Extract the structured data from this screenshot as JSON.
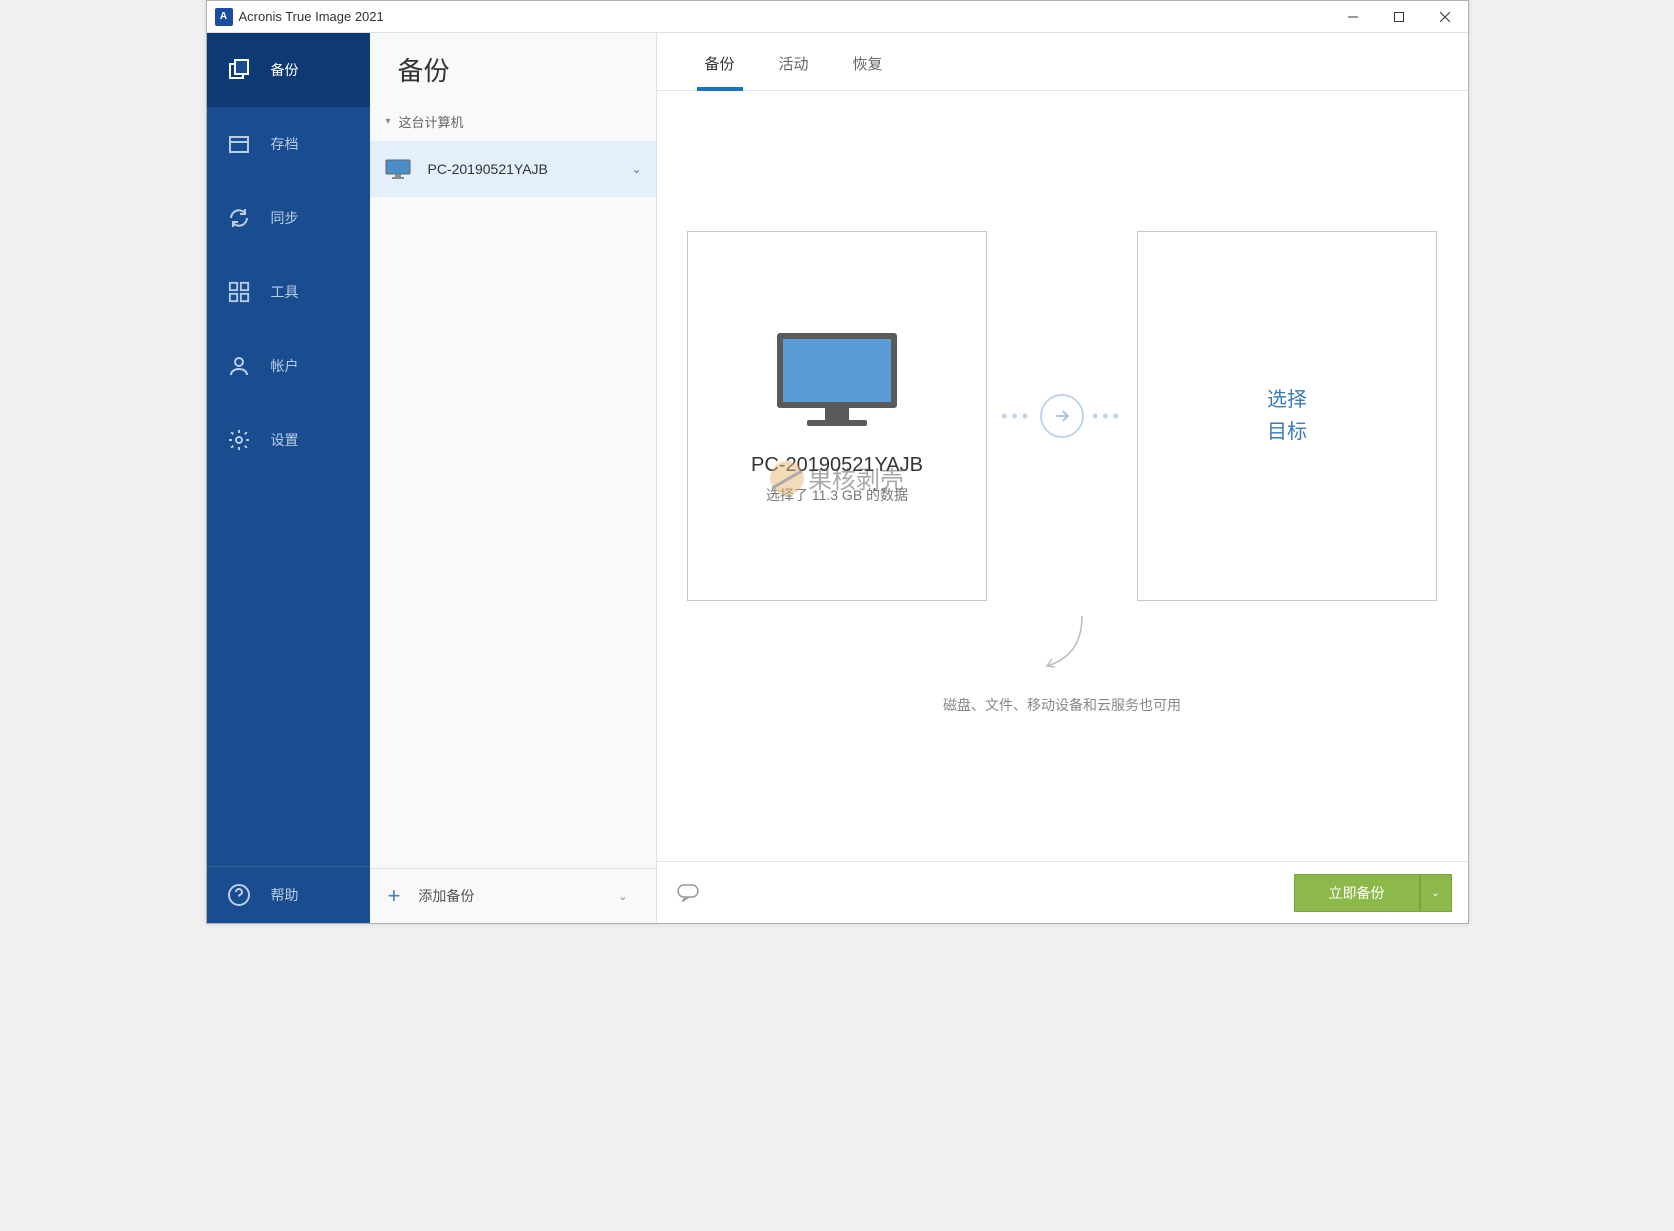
{
  "titlebar": {
    "title": "Acronis True Image 2021",
    "icon_letter": "A"
  },
  "sidebar": {
    "items": [
      {
        "label": "备份",
        "icon": "copy-icon",
        "active": true
      },
      {
        "label": "存档",
        "icon": "archive-icon",
        "active": false
      },
      {
        "label": "同步",
        "icon": "sync-icon",
        "active": false
      },
      {
        "label": "工具",
        "icon": "tools-icon",
        "active": false
      },
      {
        "label": "帐户",
        "icon": "account-icon",
        "active": false
      },
      {
        "label": "设置",
        "icon": "settings-icon",
        "active": false
      }
    ],
    "help_label": "帮助"
  },
  "backup_panel": {
    "header": "备份",
    "group_label": "这台计算机",
    "items": [
      {
        "label": "PC-20190521YAJB",
        "selected": true
      }
    ],
    "add_label": "添加备份"
  },
  "tabs": [
    {
      "label": "备份",
      "active": true
    },
    {
      "label": "活动",
      "active": false
    },
    {
      "label": "恢复",
      "active": false
    }
  ],
  "source": {
    "name": "PC-20190521YAJB",
    "size_text": "选择了 11.3 GB 的数据"
  },
  "destination": {
    "line1": "选择",
    "line2": "目标"
  },
  "hint": "磁盘、文件、移动设备和云服务也可用",
  "watermark": "果核剥壳",
  "footer": {
    "backup_now": "立即备份"
  }
}
